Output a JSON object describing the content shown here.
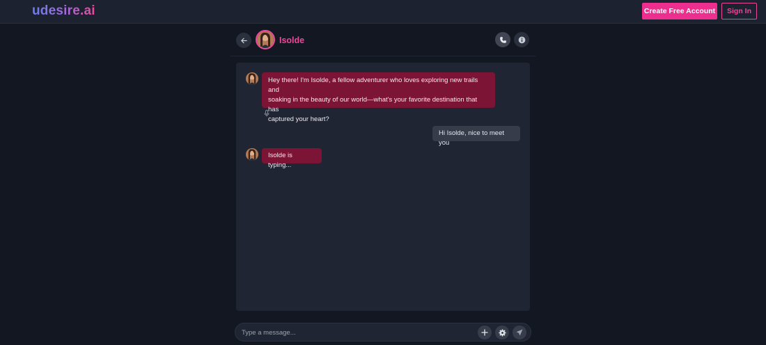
{
  "app": {
    "logo": "udesire.ai",
    "create_account_label": "Create Free Account",
    "sign_in_label": "Sign In"
  },
  "chat": {
    "character_name": "Isolde",
    "icons": {
      "back": "arrow-left-icon",
      "call": "phone-icon",
      "info": "info-icon",
      "mic": "microphone-icon",
      "add": "plus-icon",
      "settings": "gear-icon",
      "send": "send-icon"
    },
    "messages": [
      {
        "sender": "bot",
        "lines": [
          "Hey there! I'm Isolde, a fellow adventurer who loves exploring new trails and",
          "soaking in the beauty of our world—what's your favorite destination that has",
          "captured your heart?"
        ]
      },
      {
        "sender": "user",
        "text": "Hi Isolde, nice to meet you"
      },
      {
        "sender": "bot",
        "text": "Isolde is typing..."
      }
    ],
    "composer": {
      "placeholder": "Type a message..."
    }
  },
  "colors": {
    "accent": "#ec4899",
    "bot_bubble": "#7c1535",
    "user_bubble": "#363c4a",
    "background": "#121722"
  }
}
